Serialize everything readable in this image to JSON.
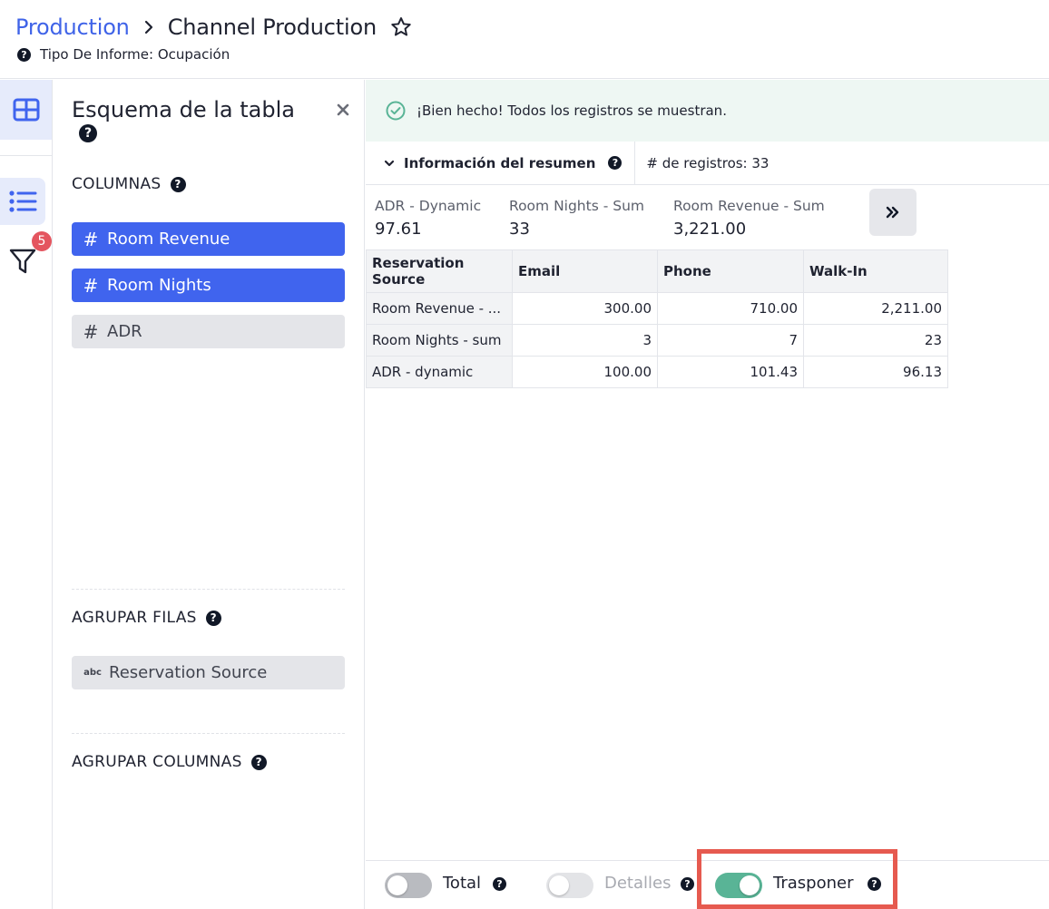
{
  "header": {
    "breadcrumb_root": "Production",
    "title": "Channel Production",
    "report_type": "Tipo De Informe: Ocupación"
  },
  "rail": {
    "filter_count": "5"
  },
  "schema": {
    "title": "Esquema de la tabla",
    "columns_label": "COLUMNAS",
    "columns": [
      {
        "tag": "#",
        "label": "Room Revenue",
        "active": true
      },
      {
        "tag": "#",
        "label": "Room Nights",
        "active": true
      },
      {
        "tag": "#",
        "label": "ADR",
        "active": false
      }
    ],
    "group_rows_label": "AGRUPAR FILAS",
    "group_rows": [
      {
        "tag": "abc",
        "label": "Reservation Source"
      }
    ],
    "group_cols_label": "AGRUPAR COLUMNAS"
  },
  "main": {
    "alert": "¡Bien hecho! Todos los registros se muestran.",
    "summary_toggle": "Información del resumen",
    "record_count": "# de registros: 33",
    "metrics": [
      {
        "label": "ADR - Dynamic",
        "value": "97.61"
      },
      {
        "label": "Room Nights - Sum",
        "value": "33"
      },
      {
        "label": "Room Revenue - Sum",
        "value": "3,221.00"
      }
    ],
    "table": {
      "headers": [
        "Reservation Source",
        "Email",
        "Phone",
        "Walk-In"
      ],
      "rows": [
        [
          "Room Revenue - ...",
          "300.00",
          "710.00",
          "2,211.00"
        ],
        [
          "Room Nights - sum",
          "3",
          "7",
          "23"
        ],
        [
          "ADR - dynamic",
          "100.00",
          "101.43",
          "96.13"
        ]
      ]
    }
  },
  "footer": {
    "total_label": "Total",
    "total_on": false,
    "details_label": "Detalles",
    "details_on": false,
    "transpose_label": "Trasponer",
    "transpose_on": true
  },
  "colors": {
    "accent": "#4064ee",
    "success": "#59b496",
    "highlight": "#e65a4f"
  }
}
